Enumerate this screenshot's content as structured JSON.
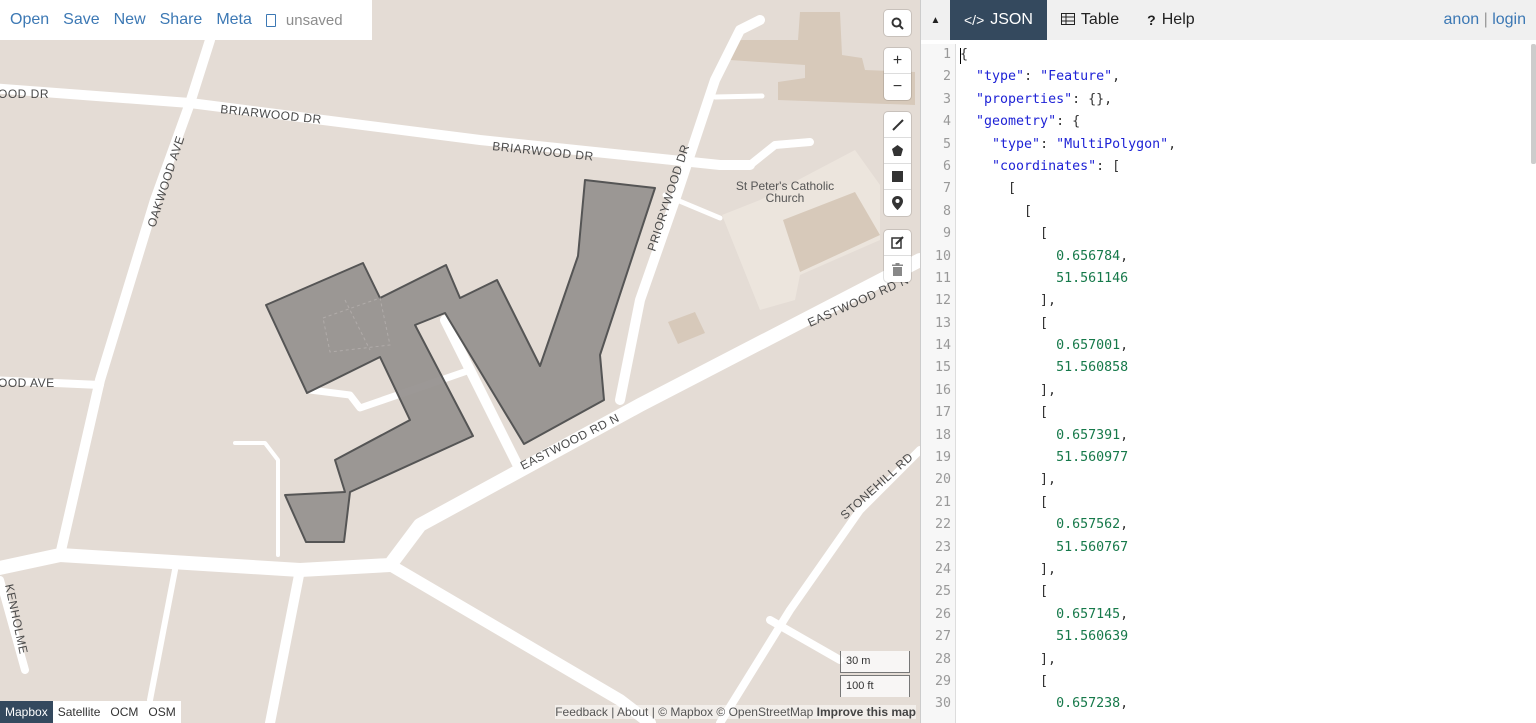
{
  "file_bar": {
    "open": "Open",
    "save": "Save",
    "new": "New",
    "share": "Share",
    "meta": "Meta",
    "unsaved": "unsaved"
  },
  "map": {
    "labels": {
      "briarwood_left": "BRIARWOOD DR",
      "briarwood_mid": "BRIARWOOD DR",
      "ood_dr": "OOD DR",
      "oakwood": "OAKWOOD AVE",
      "ood_ave": "OOD AVE",
      "priorywood": "PRIORYWOOD DR",
      "church_line1": "St Peter's Catholic",
      "church_line2": "Church",
      "eastwood_top": "EASTWOOD RD N",
      "eastwood_mid": "EASTWOOD RD N",
      "stonehill": "STONEHILL RD",
      "kenholme": "KENHOLME"
    },
    "scale": {
      "metric": "30 m",
      "imperial": "100 ft"
    },
    "basemaps": [
      "Mapbox",
      "Satellite",
      "OCM",
      "OSM"
    ],
    "active_basemap": "Mapbox",
    "attribution": {
      "feedback": "Feedback",
      "about": "About",
      "mapbox": "© Mapbox",
      "osm": "© OpenStreetMap",
      "improve": "Improve this map"
    },
    "colors": {
      "land": "#e4dcd5",
      "road": "#ffffff",
      "building": "#d7c9ba",
      "polygon_fill": "#979290",
      "polygon_stroke": "#555555"
    }
  },
  "panel": {
    "tabs": [
      {
        "label": "JSON",
        "icon": "code-icon",
        "active": true
      },
      {
        "label": "Table",
        "icon": "table-icon",
        "active": false
      },
      {
        "label": "Help",
        "icon": "question-icon",
        "active": false
      }
    ],
    "user": {
      "anon": "anon",
      "sep": "|",
      "login": "login"
    },
    "line_numbers": [
      "1",
      "2",
      "3",
      "4",
      "5",
      "6",
      "7",
      "8",
      "9",
      "10",
      "11",
      "12",
      "13",
      "14",
      "15",
      "16",
      "17",
      "18",
      "19",
      "20",
      "21",
      "22",
      "23",
      "24",
      "25",
      "26",
      "27",
      "28",
      "29",
      "30"
    ],
    "code_lines": [
      [
        {
          "t": "p",
          "v": "{"
        }
      ],
      [
        {
          "t": "p",
          "v": "  "
        },
        {
          "t": "k",
          "v": "\"type\""
        },
        {
          "t": "p",
          "v": ": "
        },
        {
          "t": "k",
          "v": "\"Feature\""
        },
        {
          "t": "p",
          "v": ","
        }
      ],
      [
        {
          "t": "p",
          "v": "  "
        },
        {
          "t": "k",
          "v": "\"properties\""
        },
        {
          "t": "p",
          "v": ": {},"
        }
      ],
      [
        {
          "t": "p",
          "v": "  "
        },
        {
          "t": "k",
          "v": "\"geometry\""
        },
        {
          "t": "p",
          "v": ": {"
        }
      ],
      [
        {
          "t": "p",
          "v": "    "
        },
        {
          "t": "k",
          "v": "\"type\""
        },
        {
          "t": "p",
          "v": ": "
        },
        {
          "t": "k",
          "v": "\"MultiPolygon\""
        },
        {
          "t": "p",
          "v": ","
        }
      ],
      [
        {
          "t": "p",
          "v": "    "
        },
        {
          "t": "k",
          "v": "\"coordinates\""
        },
        {
          "t": "p",
          "v": ": ["
        }
      ],
      [
        {
          "t": "p",
          "v": "      ["
        }
      ],
      [
        {
          "t": "p",
          "v": "        ["
        }
      ],
      [
        {
          "t": "p",
          "v": "          ["
        }
      ],
      [
        {
          "t": "p",
          "v": "            "
        },
        {
          "t": "n",
          "v": "0.656784"
        },
        {
          "t": "p",
          "v": ","
        }
      ],
      [
        {
          "t": "p",
          "v": "            "
        },
        {
          "t": "n",
          "v": "51.561146"
        }
      ],
      [
        {
          "t": "p",
          "v": "          ],"
        }
      ],
      [
        {
          "t": "p",
          "v": "          ["
        }
      ],
      [
        {
          "t": "p",
          "v": "            "
        },
        {
          "t": "n",
          "v": "0.657001"
        },
        {
          "t": "p",
          "v": ","
        }
      ],
      [
        {
          "t": "p",
          "v": "            "
        },
        {
          "t": "n",
          "v": "51.560858"
        }
      ],
      [
        {
          "t": "p",
          "v": "          ],"
        }
      ],
      [
        {
          "t": "p",
          "v": "          ["
        }
      ],
      [
        {
          "t": "p",
          "v": "            "
        },
        {
          "t": "n",
          "v": "0.657391"
        },
        {
          "t": "p",
          "v": ","
        }
      ],
      [
        {
          "t": "p",
          "v": "            "
        },
        {
          "t": "n",
          "v": "51.560977"
        }
      ],
      [
        {
          "t": "p",
          "v": "          ],"
        }
      ],
      [
        {
          "t": "p",
          "v": "          ["
        }
      ],
      [
        {
          "t": "p",
          "v": "            "
        },
        {
          "t": "n",
          "v": "0.657562"
        },
        {
          "t": "p",
          "v": ","
        }
      ],
      [
        {
          "t": "p",
          "v": "            "
        },
        {
          "t": "n",
          "v": "51.560767"
        }
      ],
      [
        {
          "t": "p",
          "v": "          ],"
        }
      ],
      [
        {
          "t": "p",
          "v": "          ["
        }
      ],
      [
        {
          "t": "p",
          "v": "            "
        },
        {
          "t": "n",
          "v": "0.657145"
        },
        {
          "t": "p",
          "v": ","
        }
      ],
      [
        {
          "t": "p",
          "v": "            "
        },
        {
          "t": "n",
          "v": "51.560639"
        }
      ],
      [
        {
          "t": "p",
          "v": "          ],"
        }
      ],
      [
        {
          "t": "p",
          "v": "          ["
        }
      ],
      [
        {
          "t": "p",
          "v": "            "
        },
        {
          "t": "n",
          "v": "0.657238"
        },
        {
          "t": "p",
          "v": ","
        }
      ]
    ]
  }
}
